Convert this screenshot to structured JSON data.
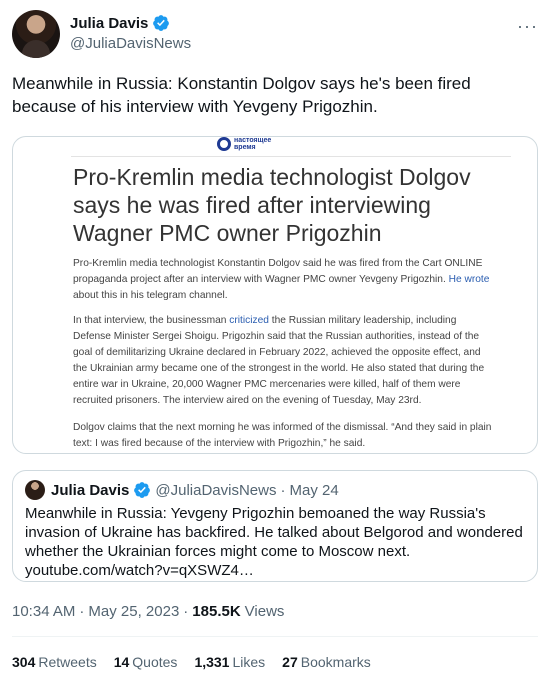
{
  "tweet": {
    "author_name": "Julia Davis",
    "author_handle": "@JuliaDavisNews",
    "more_icon": "ellipsis-icon",
    "text": "Meanwhile in Russia: Konstantin Dolgov says he's been fired because of his interview with Yevgeny Prigozhin.",
    "time": "10:34 AM",
    "date": "May 25, 2023",
    "views_count": "185.5K",
    "views_label": "Views",
    "separator": "·"
  },
  "media": {
    "source_line1": "настоящее",
    "source_line2": "время",
    "headline": "Pro-Kremlin media technologist Dolgov says he was fired after interviewing Wagner PMC owner Prigozhin",
    "para1_before_link": "Pro-Kremlin media technologist Konstantin Dolgov said he was fired from the Cart ONLINE propaganda project after an interview with Wagner PMC owner Yevgeny Prigozhin. ",
    "para1_link": "He wrote",
    "para1_after_link": " about this in his telegram channel.",
    "para2_before_link": "In that interview, the businessman ",
    "para2_link": "criticized",
    "para2_after_link": " the Russian military leadership, including Defense Minister Sergei Shoigu. Prigozhin said that the Russian authorities, instead of the goal of demilitarizing Ukraine declared in February 2022, achieved the opposite effect, and the Ukrainian army became one of the strongest in the world. He also stated that during the entire war in Ukraine, 20,000 Wagner PMC mercenaries were killed, half of them were recruited prisoners. The interview aired on the evening of Tuesday, May 23rd.",
    "para3": "Dolgov claims that the next morning he was informed of the dismissal. “And they said in plain text: I was fired because of the interview with Prigozhin,” he said."
  },
  "quote": {
    "author_name": "Julia Davis",
    "author_handle": "@JuliaDavisNews",
    "separator": "·",
    "date": "May 24",
    "text": "Meanwhile in Russia: Yevgeny Prigozhin bemoaned the way Russia's invasion of Ukraine has backfired. He talked about Belgorod and wondered whether the Ukrainian forces might come to Moscow next.",
    "link": "youtube.com/watch?v=qXSWZ4…"
  },
  "stats": [
    {
      "count": "304",
      "label": "Retweets"
    },
    {
      "count": "14",
      "label": "Quotes"
    },
    {
      "count": "1,331",
      "label": "Likes"
    },
    {
      "count": "27",
      "label": "Bookmarks"
    }
  ],
  "colors": {
    "verified": "#1d9bf0",
    "secondary_text": "#536471",
    "link": "#2a5db0"
  }
}
